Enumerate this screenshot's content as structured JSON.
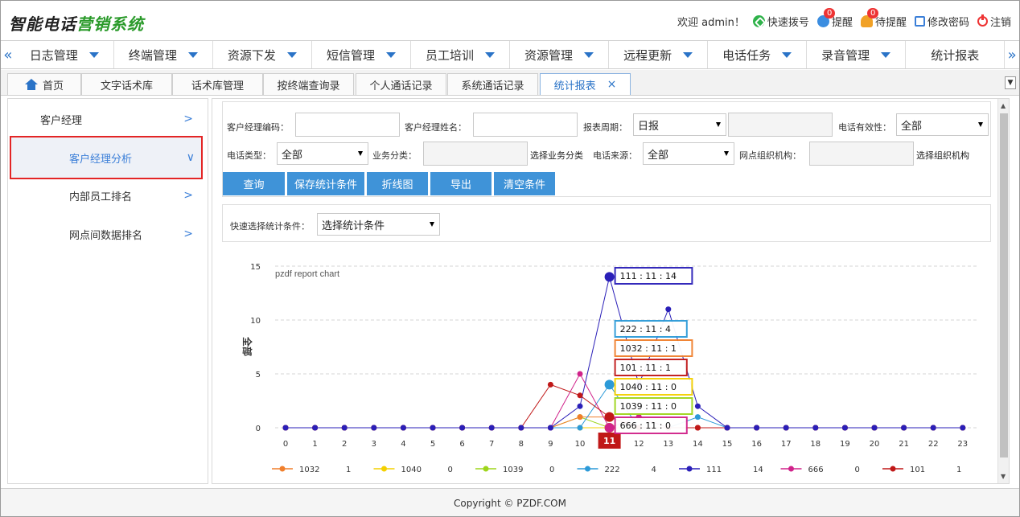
{
  "app": {
    "brand_part1": "智能电话",
    "brand_part2": "营销系统"
  },
  "top": {
    "welcome": "欢迎 admin！",
    "quick_dial": "快速拨号",
    "remind": "提醒",
    "remind_count": "0",
    "pending": "待提醒",
    "pending_count": "0",
    "change_pwd": "修改密码",
    "logout": "注销"
  },
  "menu": {
    "items": [
      {
        "label": "日志管理"
      },
      {
        "label": "终端管理"
      },
      {
        "label": "资源下发"
      },
      {
        "label": "短信管理"
      },
      {
        "label": "员工培训"
      },
      {
        "label": "资源管理"
      },
      {
        "label": "远程更新"
      },
      {
        "label": "电话任务"
      },
      {
        "label": "录音管理"
      },
      {
        "label": "统计报表"
      }
    ]
  },
  "tabs": [
    {
      "label": "首页"
    },
    {
      "label": "文字话术库"
    },
    {
      "label": "话术库管理"
    },
    {
      "label": "按终端查询录"
    },
    {
      "label": "个人通话记录"
    },
    {
      "label": "系统通话记录"
    },
    {
      "label": "统计报表"
    }
  ],
  "sidebar": {
    "items": [
      {
        "label": "客户经理"
      },
      {
        "label": "客户经理分析"
      },
      {
        "label": "内部员工排名"
      },
      {
        "label": "网点间数据排名"
      }
    ]
  },
  "filters": {
    "manager_code_label": "客户经理编码：",
    "manager_name_label": "客户经理姓名：",
    "period_label": "报表周期：",
    "period_value": "日报",
    "validity_label": "电话有效性：",
    "validity_value": "全部",
    "call_type_label": "电话类型：",
    "call_type_value": "全部",
    "biz_label": "业务分类：",
    "biz_select": "选择业务分类",
    "source_label": "电话来源：",
    "source_value": "全部",
    "org_label": "网点组织机构：",
    "org_select": "选择组织机构"
  },
  "buttons": {
    "query": "查询",
    "save": "保存统计条件",
    "line": "折线图",
    "export": "导出",
    "clear": "清空条件"
  },
  "quick": {
    "label": "快速选择统计条件：",
    "value": "选择统计条件"
  },
  "footer": {
    "text": "Copyright © PZDF.COM"
  },
  "chart_data": {
    "type": "line",
    "title": "pzdf report chart",
    "ylabel": "全部",
    "ylim": [
      0,
      15
    ],
    "yticks": [
      0,
      5,
      10,
      15
    ],
    "x": [
      0,
      1,
      2,
      3,
      4,
      5,
      6,
      7,
      8,
      9,
      10,
      11,
      12,
      13,
      14,
      15,
      16,
      17,
      18,
      19,
      20,
      21,
      22,
      23
    ],
    "highlight_x": "11",
    "series": [
      {
        "name": "1032",
        "color": "#f07f2c",
        "values": [
          0,
          0,
          0,
          0,
          0,
          0,
          0,
          0,
          0,
          0,
          1,
          1,
          0,
          0,
          0,
          0,
          0,
          0,
          0,
          0,
          0,
          0,
          0,
          0
        ],
        "tooltip": "1032 : 11 : 1",
        "legend_value": "1"
      },
      {
        "name": "1040",
        "color": "#f4d000",
        "values": [
          0,
          0,
          0,
          0,
          0,
          0,
          0,
          0,
          0,
          0,
          0,
          0,
          0,
          0,
          0,
          0,
          0,
          0,
          0,
          0,
          0,
          0,
          0,
          0
        ],
        "tooltip": "1040 : 11 : 0",
        "legend_value": "0"
      },
      {
        "name": "1039",
        "color": "#9ed51b",
        "values": [
          0,
          0,
          0,
          0,
          0,
          0,
          0,
          0,
          0,
          0,
          1,
          0,
          1,
          0,
          0,
          0,
          0,
          0,
          0,
          0,
          0,
          0,
          0,
          0
        ],
        "tooltip": "1039 : 11 : 0",
        "legend_value": "0"
      },
      {
        "name": "222",
        "color": "#2c9ad8",
        "values": [
          0,
          0,
          0,
          0,
          0,
          0,
          0,
          0,
          0,
          0,
          0,
          4,
          0,
          0,
          1,
          0,
          0,
          0,
          0,
          0,
          0,
          0,
          0,
          0
        ],
        "tooltip": "222 : 11 : 4",
        "legend_value": "4"
      },
      {
        "name": "111",
        "color": "#2a1fb8",
        "values": [
          0,
          0,
          0,
          0,
          0,
          0,
          0,
          0,
          0,
          0,
          2,
          14,
          4,
          11,
          2,
          0,
          0,
          0,
          0,
          0,
          0,
          0,
          0,
          0
        ],
        "tooltip": "111 : 11 : 14",
        "legend_value": "14"
      },
      {
        "name": "666",
        "color": "#d0228a",
        "values": [
          0,
          0,
          0,
          0,
          0,
          0,
          0,
          0,
          0,
          0,
          5,
          0,
          1,
          0,
          0,
          0,
          0,
          0,
          0,
          0,
          0,
          0,
          0,
          0
        ],
        "tooltip": "666 : 11 : 0",
        "legend_value": "0"
      },
      {
        "name": "101",
        "color": "#c01818",
        "values": [
          0,
          0,
          0,
          0,
          0,
          0,
          0,
          0,
          0,
          4,
          3,
          1,
          0,
          0,
          0,
          0,
          0,
          0,
          0,
          0,
          0,
          0,
          0,
          0
        ],
        "tooltip": "101 : 11 : 1",
        "legend_value": "1"
      }
    ]
  }
}
